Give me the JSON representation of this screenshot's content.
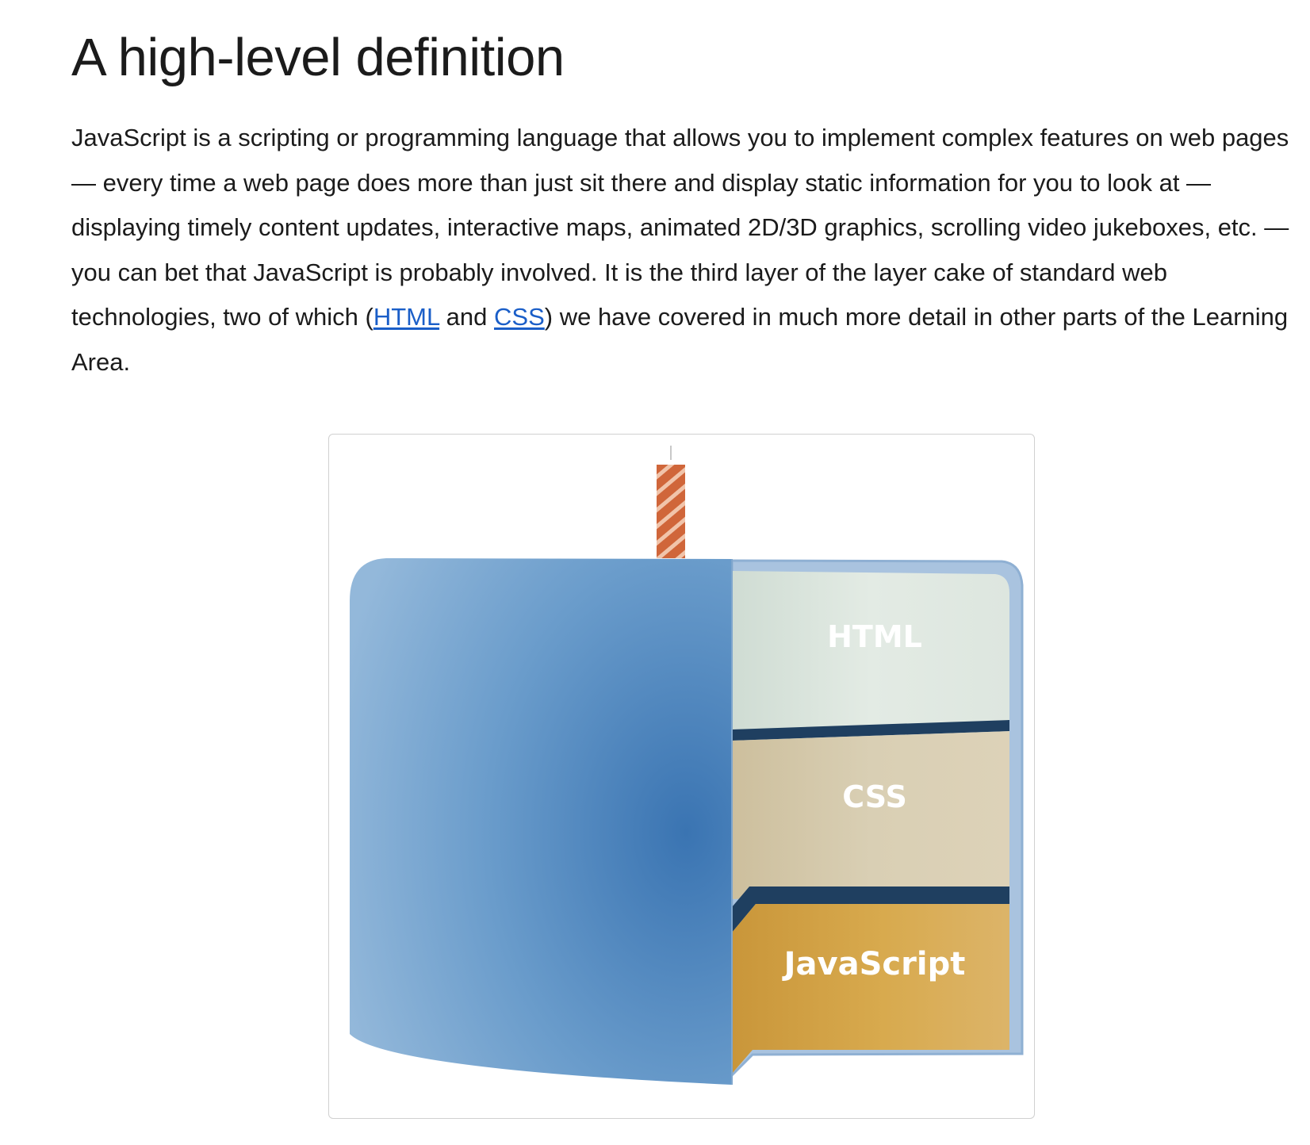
{
  "heading": "A high-level definition",
  "paragraph": {
    "text_1": "JavaScript is a scripting or programming language that allows you to implement complex features on web pages — every time a web page does more than just sit there and display static information for you to look at — displaying timely content updates, interactive maps, animated 2D/3D graphics, scrolling video jukeboxes, etc. — you can bet that JavaScript is probably involved. It is the third layer of the layer cake of standard web technologies, two of which (",
    "link_html": "HTML",
    "text_2": " and ",
    "link_css": "CSS",
    "text_3": ") we have covered in much more detail in other parts of the Learning Area."
  },
  "figure": {
    "layers": [
      {
        "label": "HTML",
        "color": "#dfe8e1"
      },
      {
        "label": "CSS",
        "color": "#d6cbb0"
      },
      {
        "label": "JavaScript",
        "color": "#d4a84a"
      }
    ],
    "cake_color": "#4f86bd",
    "candle_color": "#d0663a",
    "divider_color": "#1f3f60"
  }
}
